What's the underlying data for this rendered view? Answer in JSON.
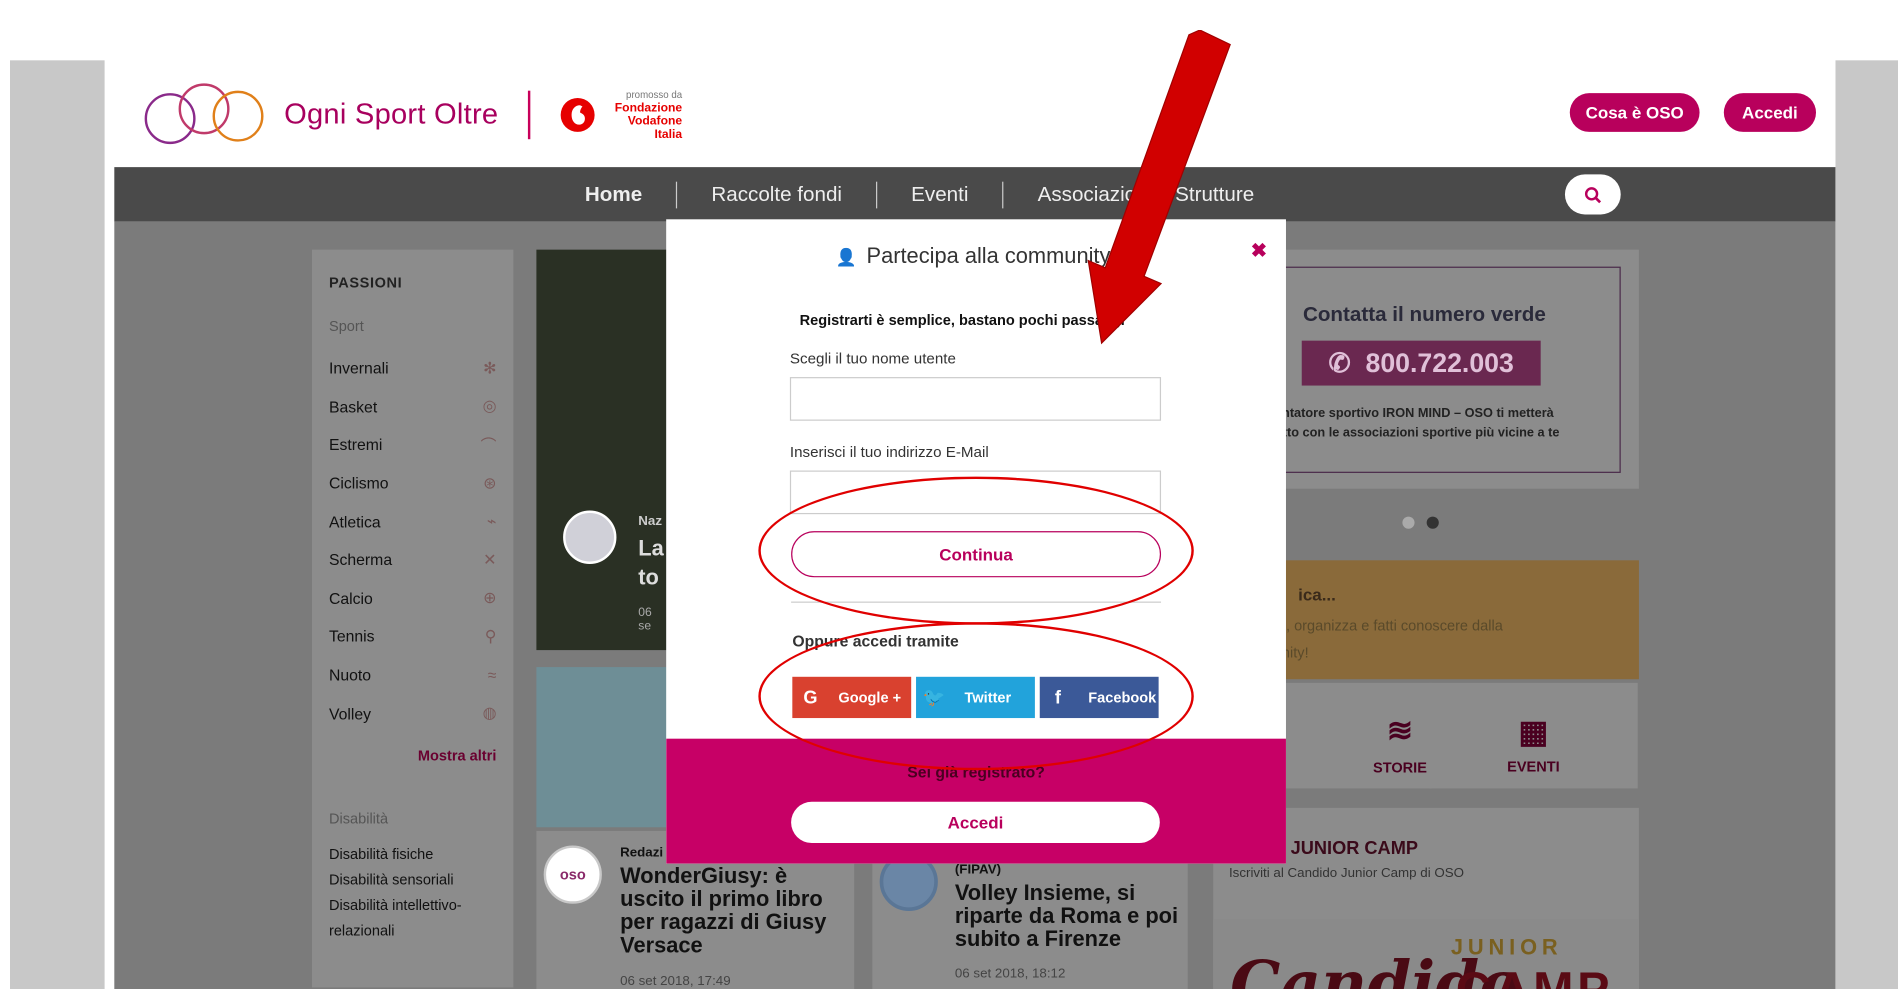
{
  "header": {
    "brand": "Ogni Sport Oltre",
    "promo_small": "promosso da",
    "promo_1": "Fondazione",
    "promo_2": "Vodafone",
    "promo_3": "Italia",
    "btn_cosa": "Cosa è OSO",
    "btn_accedi": "Accedi"
  },
  "nav": {
    "items": [
      "Home",
      "Raccolte fondi",
      "Eventi",
      "Associazioni e Strutture"
    ]
  },
  "sidebar": {
    "title": "PASSIONI",
    "sport_label": "Sport",
    "items": [
      "Invernali",
      "Basket",
      "Estremi",
      "Ciclismo",
      "Atletica",
      "Scherma",
      "Calcio",
      "Tennis",
      "Nuoto",
      "Volley"
    ],
    "more": "Mostra altri",
    "disability_label": "Disabilità",
    "disability_items": [
      "Disabilità fisiche",
      "Disabilità sensoriali",
      "Disabilità intellettivo-relazionali"
    ]
  },
  "modal": {
    "title": "Partecipa alla community!",
    "intro": "Registrarti è semplice, bastano pochi passaggi",
    "username_label": "Scegli il tuo nome utente",
    "email_label": "Inserisci il tuo indirizzo E-Mail",
    "continue": "Continua",
    "oppure": "Oppure accedi tramite",
    "google": "Google +",
    "twitter": "Twitter",
    "facebook": "Facebook",
    "already": "Sei già registrato?",
    "login": "Accedi"
  },
  "right": {
    "verde_title": "Contatta il numero verde",
    "verde_number": "800.722.003",
    "verde_desc_1": "ientatore sportivo IRON MIND – OSO ti metterà",
    "verde_desc_2": "tatto con le associazioni sportive più vicine a te",
    "promo_title": "ica...",
    "promo_desc_1": "ta, organizza e fatti conoscere dalla",
    "promo_desc_2": "unity!",
    "storie": "STORIE",
    "eventi": "EVENTI",
    "camp_title": "IDO JUNIOR CAMP",
    "camp_desc": "Iscriviti al Candido Junior Camp di OSO",
    "camp_logo_1": "Candido",
    "camp_logo_2": "JUNIOR",
    "camp_logo_3": "CAMP"
  },
  "hero": {
    "line1": "Naz",
    "line2": "La",
    "line3": "to",
    "date": "06 se"
  },
  "news": [
    {
      "author": "Redazi",
      "title": "WonderGiusy: è uscito il primo libro per ragazzi di Giusy Versace",
      "date": "06 set 2018, 17:49"
    },
    {
      "author": "(FIPAV)",
      "title": "Volley Insieme, si riparte da Roma e poi subito a Firenze",
      "date": "06 set 2018, 18:12"
    }
  ],
  "colors": {
    "brand": "#b8005c",
    "annotation": "#e00000",
    "nav": "#4a4a4a"
  }
}
